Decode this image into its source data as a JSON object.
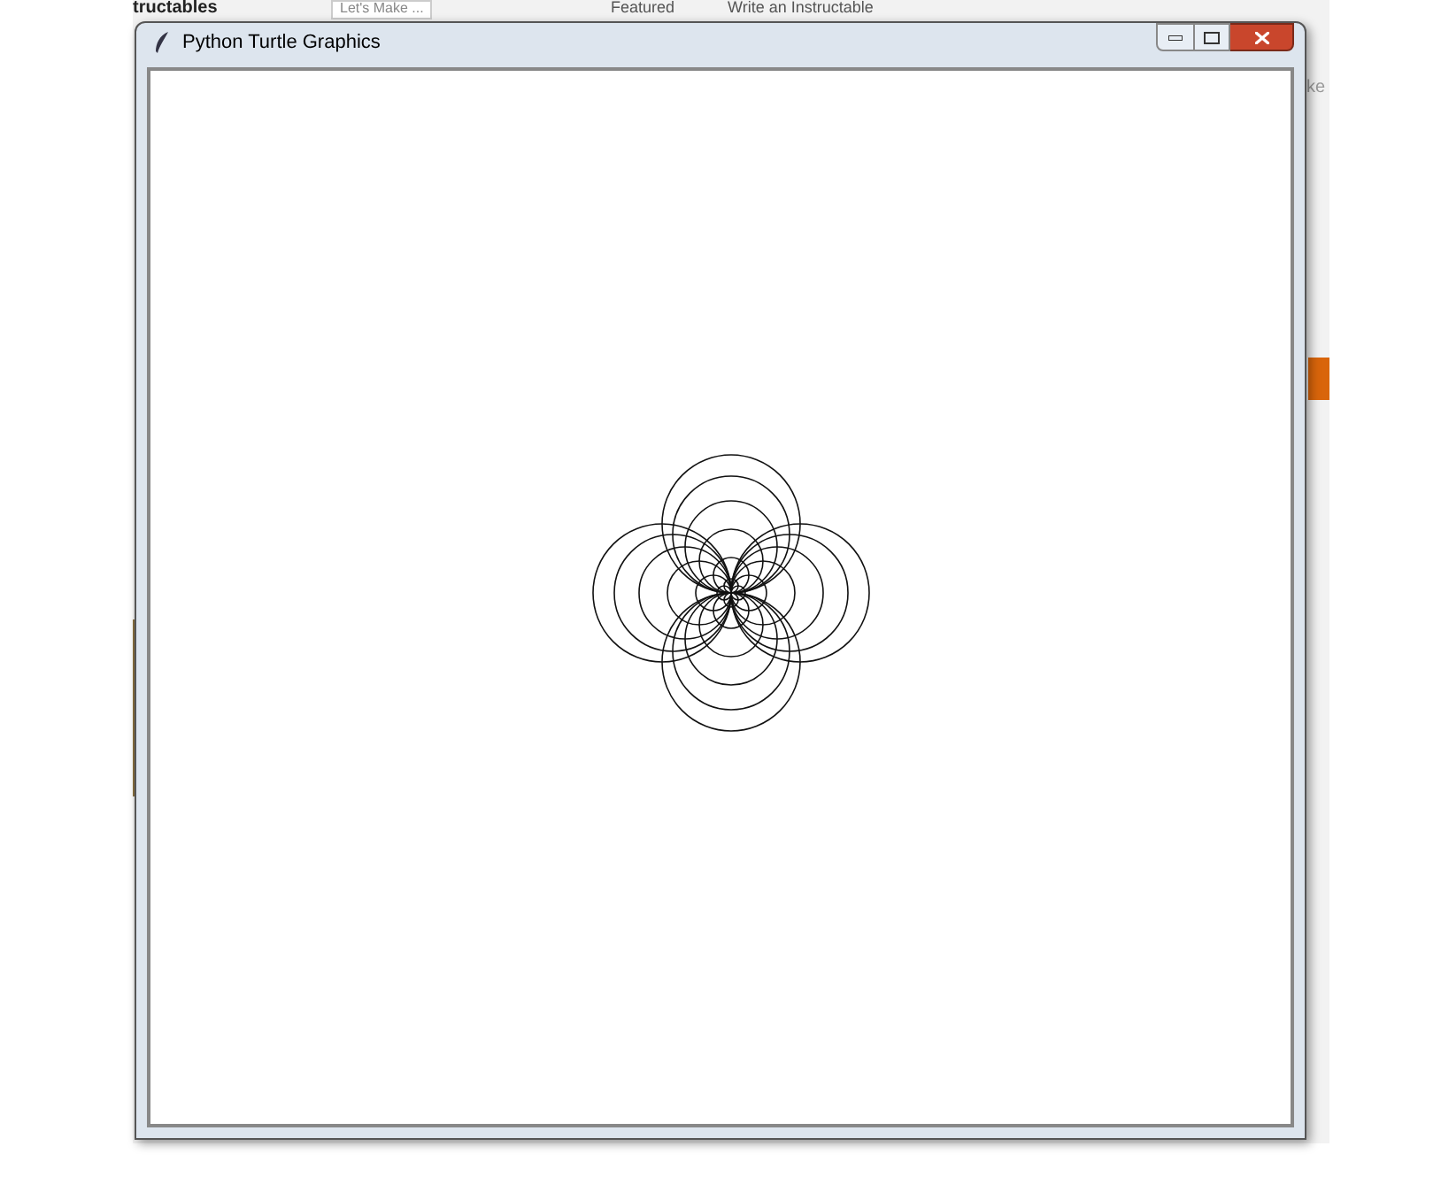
{
  "background_page": {
    "logo": "tructables",
    "search_placeholder": "Let's Make ...",
    "nav_links": [
      "Featured",
      "Write an Instructable"
    ],
    "side_text": "ke"
  },
  "window": {
    "title": "Python Turtle Graphics"
  }
}
